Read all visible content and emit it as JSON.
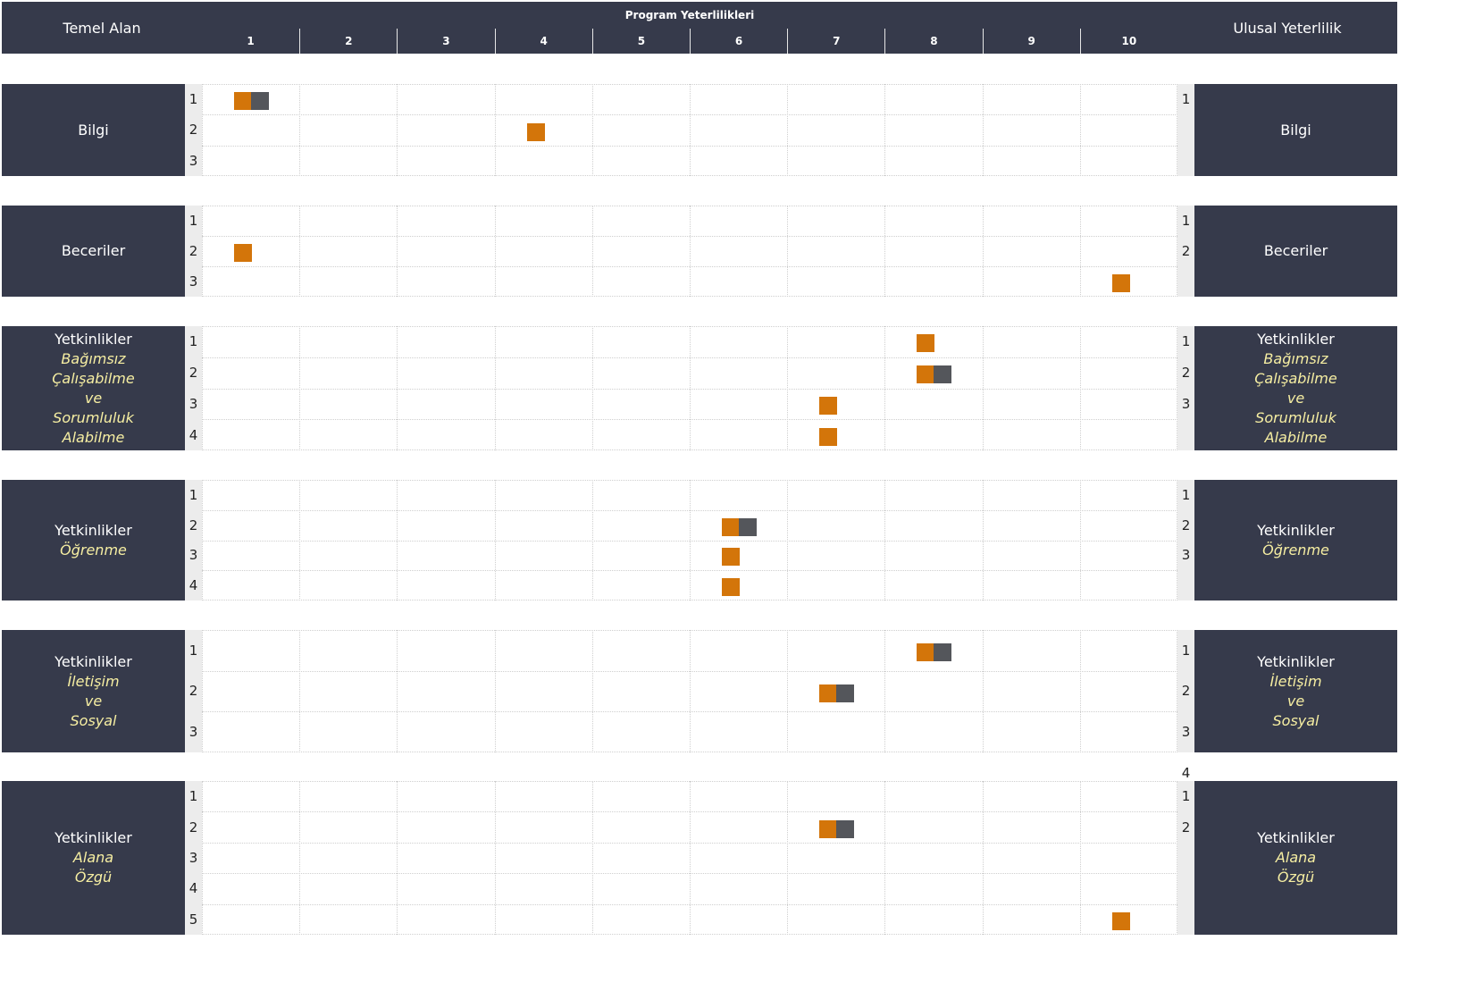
{
  "header": {
    "left_title": "Temel Alan",
    "center_title": "Program Yeterlilikleri",
    "right_title": "Ulusal Yeterlilik",
    "columns": [
      "1",
      "2",
      "3",
      "4",
      "5",
      "6",
      "7",
      "8",
      "9",
      "10"
    ]
  },
  "legend_colors": {
    "primary": "#d3750a",
    "secondary": "#54565b",
    "panel": "#363a4b",
    "subtitle": "#f6eea2"
  },
  "sections": [
    {
      "left_label": [
        "Bilgi"
      ],
      "right_label": [
        "Bilgi"
      ],
      "left_numbers": [
        "1",
        "2",
        "3"
      ],
      "right_numbers": [
        "1"
      ],
      "marks": [
        {
          "row": 1,
          "col": 1,
          "level": 2
        },
        {
          "row": 2,
          "col": 4,
          "level": 1
        }
      ]
    },
    {
      "left_label": [
        "Beceriler"
      ],
      "right_label": [
        "Beceriler"
      ],
      "left_numbers": [
        "1",
        "2",
        "3"
      ],
      "right_numbers": [
        "1",
        "2"
      ],
      "marks": [
        {
          "row": 2,
          "col": 1,
          "level": 1
        },
        {
          "row": 3,
          "col": 10,
          "level": 1
        }
      ]
    },
    {
      "left_label": [
        "Yetkinlikler",
        "Bağımsız",
        "Çalışabilme",
        "ve",
        "Sorumluluk",
        "Alabilme"
      ],
      "right_label": [
        "Yetkinlikler",
        "Bağımsız",
        "Çalışabilme",
        "ve",
        "Sorumluluk",
        "Alabilme"
      ],
      "left_numbers": [
        "1",
        "2",
        "3",
        "4"
      ],
      "right_numbers": [
        "1",
        "2",
        "3"
      ],
      "marks": [
        {
          "row": 1,
          "col": 8,
          "level": 1
        },
        {
          "row": 2,
          "col": 8,
          "level": 2
        },
        {
          "row": 3,
          "col": 7,
          "level": 1
        },
        {
          "row": 4,
          "col": 7,
          "level": 1
        }
      ]
    },
    {
      "left_label": [
        "Yetkinlikler",
        "Öğrenme"
      ],
      "right_label": [
        "Yetkinlikler",
        "Öğrenme"
      ],
      "left_numbers": [
        "1",
        "2",
        "3",
        "4"
      ],
      "right_numbers": [
        "1",
        "2",
        "3"
      ],
      "marks": [
        {
          "row": 2,
          "col": 6,
          "level": 2
        },
        {
          "row": 3,
          "col": 6,
          "level": 1
        },
        {
          "row": 4,
          "col": 6,
          "level": 1
        }
      ]
    },
    {
      "left_label": [
        "Yetkinlikler",
        "İletişim",
        "ve",
        "Sosyal"
      ],
      "right_label": [
        "Yetkinlikler",
        "İletişim",
        "ve",
        "Sosyal"
      ],
      "left_numbers": [
        "1",
        "2",
        "3"
      ],
      "right_numbers": [
        "1",
        "2",
        "3",
        "4"
      ],
      "marks": [
        {
          "row": 1,
          "col": 8,
          "level": 2
        },
        {
          "row": 2,
          "col": 7,
          "level": 2
        }
      ]
    },
    {
      "left_label": [
        "Yetkinlikler",
        "Alana",
        "Özgü"
      ],
      "right_label": [
        "Yetkinlikler",
        "Alana",
        "Özgü"
      ],
      "left_numbers": [
        "1",
        "2",
        "3",
        "4",
        "5"
      ],
      "right_numbers": [
        "1",
        "2"
      ],
      "marks": [
        {
          "row": 2,
          "col": 7,
          "level": 2
        },
        {
          "row": 5,
          "col": 10,
          "level": 1
        }
      ]
    }
  ]
}
